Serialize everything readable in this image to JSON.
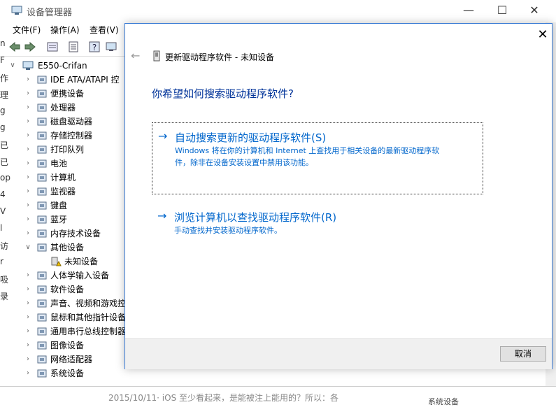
{
  "window": {
    "title": "设备管理器",
    "minimize_glyph": "—",
    "maximize_glyph": "☐",
    "close_glyph": "✕"
  },
  "menu": {
    "file": "文件(F)",
    "action": "操作(A)",
    "view": "查看(V)"
  },
  "toolbar": {
    "icons": [
      "back-arrow-icon",
      "forward-arrow-icon",
      "properties-icon",
      "device-list-icon",
      "help-icon",
      "device-view-icon"
    ]
  },
  "tree": {
    "root": "E550-Crifan",
    "items": [
      {
        "label": "IDE ATA/ATAPI 控",
        "icon": "ide-controller-icon"
      },
      {
        "label": "便携设备",
        "icon": "portable-device-icon"
      },
      {
        "label": "处理器",
        "icon": "processor-icon"
      },
      {
        "label": "磁盘驱动器",
        "icon": "disk-drive-icon"
      },
      {
        "label": "存储控制器",
        "icon": "storage-controller-icon"
      },
      {
        "label": "打印队列",
        "icon": "printer-icon"
      },
      {
        "label": "电池",
        "icon": "battery-icon"
      },
      {
        "label": "计算机",
        "icon": "computer-icon"
      },
      {
        "label": "监视器",
        "icon": "monitor-icon"
      },
      {
        "label": "键盘",
        "icon": "keyboard-icon"
      },
      {
        "label": "蓝牙",
        "icon": "bluetooth-icon"
      },
      {
        "label": "内存技术设备",
        "icon": "memory-device-icon"
      },
      {
        "label": "其他设备",
        "icon": "other-devices-icon"
      },
      {
        "label": "未知设备",
        "icon": "unknown-device-warning-icon"
      },
      {
        "label": "人体学输入设备",
        "icon": "hid-icon"
      },
      {
        "label": "软件设备",
        "icon": "software-device-icon"
      },
      {
        "label": "声音、视频和游戏控",
        "icon": "audio-icon"
      },
      {
        "label": "鼠标和其他指针设备",
        "icon": "mouse-icon"
      },
      {
        "label": "通用串行总线控制器",
        "icon": "usb-icon"
      },
      {
        "label": "图像设备",
        "icon": "imaging-device-icon"
      },
      {
        "label": "网络适配器",
        "icon": "network-adapter-icon"
      },
      {
        "label": "系统设备",
        "icon": "system-device-icon"
      }
    ]
  },
  "peek_chars": [
    "n",
    "F",
    "作",
    "理",
    "g",
    "g",
    "已",
    "已",
    "op",
    "4",
    "V",
    "l",
    "访",
    "r",
    "吸",
    "录"
  ],
  "background_bottom": {
    "text": "2015/10/11· iOS 至少看起来，是能被注上能用的？所以：各",
    "right_text": "系统设备"
  },
  "dialog": {
    "close_glyph": "✕",
    "back_glyph": "←",
    "header": "更新驱动程序软件 - 未知设备",
    "question": "你希望如何搜索驱动程序软件?",
    "option_auto": {
      "arrow": "→",
      "title": "自动搜索更新的驱动程序软件(S)",
      "desc_line1": "Windows 将在你的计算机和 Internet 上查找用于相关设备的最新驱动程序软",
      "desc_line2": "件，除非在设备安装设置中禁用该功能。"
    },
    "option_browse": {
      "arrow": "→",
      "title": "浏览计算机以查找驱动程序软件(R)",
      "desc": "手动查找并安装驱动程序软件。"
    },
    "cancel": "取消"
  },
  "colors": {
    "link_blue": "#0066cc",
    "question_blue": "#003399",
    "dialog_border": "#3a7bd5"
  }
}
